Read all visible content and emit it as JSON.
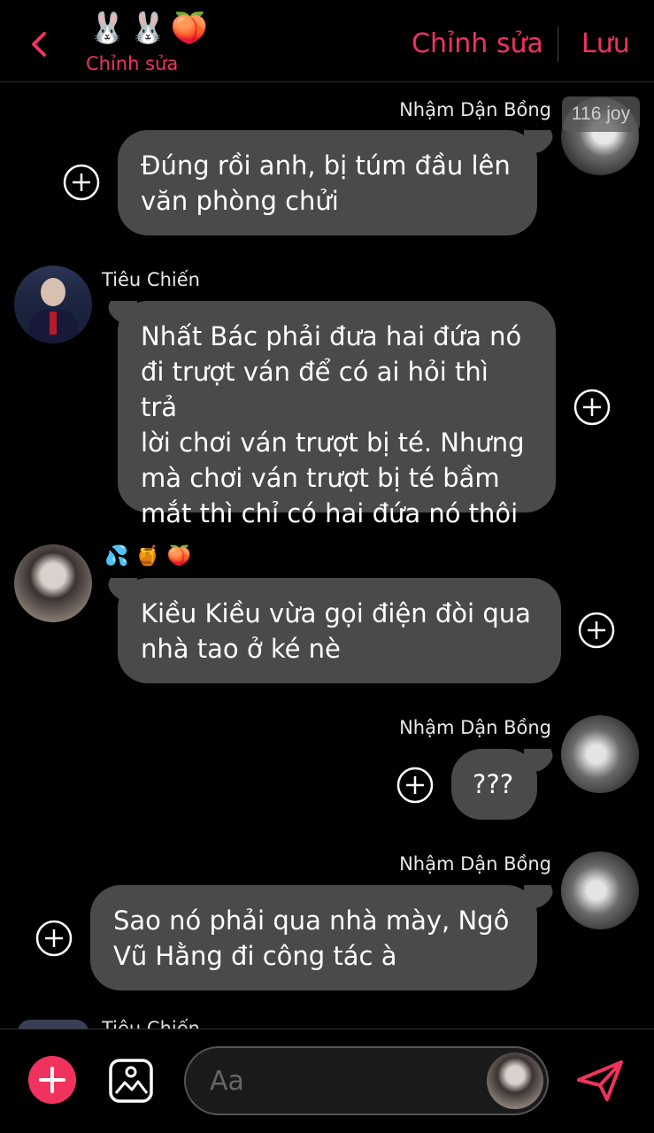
{
  "header": {
    "back_icon": "chevron-left-icon",
    "emojis": "🐰🐰🍑",
    "subtitle": "Chỉnh sửa",
    "edit_label": "Chỉnh sửa",
    "save_label": "Lưu",
    "accent_color": "#f0335e"
  },
  "watermark": "116 joy",
  "messages": [
    {
      "sender": "Nhậm Dận Bồng",
      "side": "right",
      "text_lines": [
        "Đúng rồi anh, bị túm đầu lên",
        "văn phòng chửi"
      ]
    },
    {
      "sender": "Tiêu Chiến",
      "side": "left",
      "text_lines": [
        "Nhất Bác phải đưa hai đứa nó",
        "đi trượt ván để có ai hỏi thì trả",
        "lời chơi ván trượt bị té. Nhưng",
        "mà chơi ván trượt bị té bầm",
        "mắt thì chỉ có hai đứa nó thôi"
      ]
    },
    {
      "sender": "💦🍯🍑",
      "side": "left",
      "text_lines": [
        "Kiều Kiều vừa gọi điện đòi qua",
        "nhà tao ở ké nè"
      ]
    },
    {
      "sender": "Nhậm Dận Bồng",
      "side": "right",
      "text_lines": [
        "???"
      ]
    },
    {
      "sender": "Nhậm Dận Bồng",
      "side": "right",
      "text_lines": [
        "Sao nó phải qua nhà mày, Ngô",
        "Vũ Hằng đi công tác à"
      ]
    }
  ],
  "peek": {
    "sender": "Tiêu Chiến"
  },
  "composer": {
    "placeholder": "Aa",
    "add_icon": "plus-icon",
    "image_icon": "image-icon",
    "send_icon": "send-icon"
  }
}
